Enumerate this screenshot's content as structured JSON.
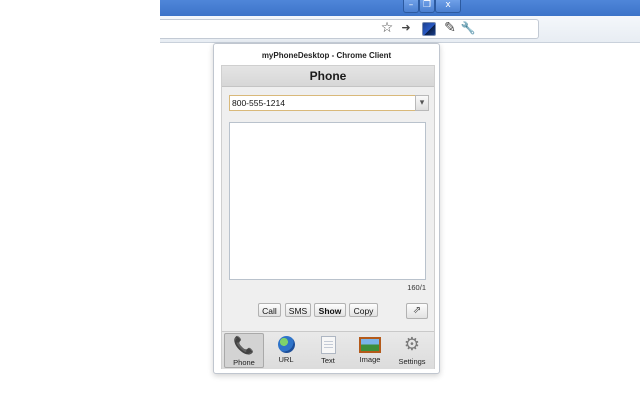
{
  "window": {
    "minimize_glyph": "–",
    "maximize_glyph": "❐",
    "close_glyph": "x"
  },
  "toolbar": {
    "icons": [
      "star-icon",
      "extension-mobile-icon",
      "myphonedesktop-icon",
      "edit-icon",
      "wrench-icon"
    ],
    "star_glyph": "☆",
    "mobile_glyph": "➜",
    "edit_glyph": "✎",
    "wrench_glyph": "🔧"
  },
  "popup": {
    "title": "myPhoneDesktop - Chrome Client",
    "header": "Phone",
    "number_value": "800-555-1214",
    "dropdown_glyph": "▾",
    "message_value": "",
    "counter": "160/1",
    "buttons": {
      "call": "Call",
      "sms": "SMS",
      "show": "Show",
      "copy": "Copy"
    },
    "share_glyph": "⇗",
    "tabs": [
      {
        "label": "Phone",
        "icon": "phone-icon",
        "glyph": "📞",
        "active": true
      },
      {
        "label": "URL",
        "icon": "globe-icon",
        "glyph": "",
        "active": false
      },
      {
        "label": "Text",
        "icon": "text-document-icon",
        "glyph": "",
        "active": false
      },
      {
        "label": "Image",
        "icon": "image-icon",
        "glyph": "",
        "active": false
      },
      {
        "label": "Settings",
        "icon": "gear-icon",
        "glyph": "⚙",
        "active": false
      }
    ]
  },
  "colors": {
    "titlebar": "#4f86d9",
    "input_focus_border": "#d9b97a",
    "panel_background": "#efefef"
  }
}
